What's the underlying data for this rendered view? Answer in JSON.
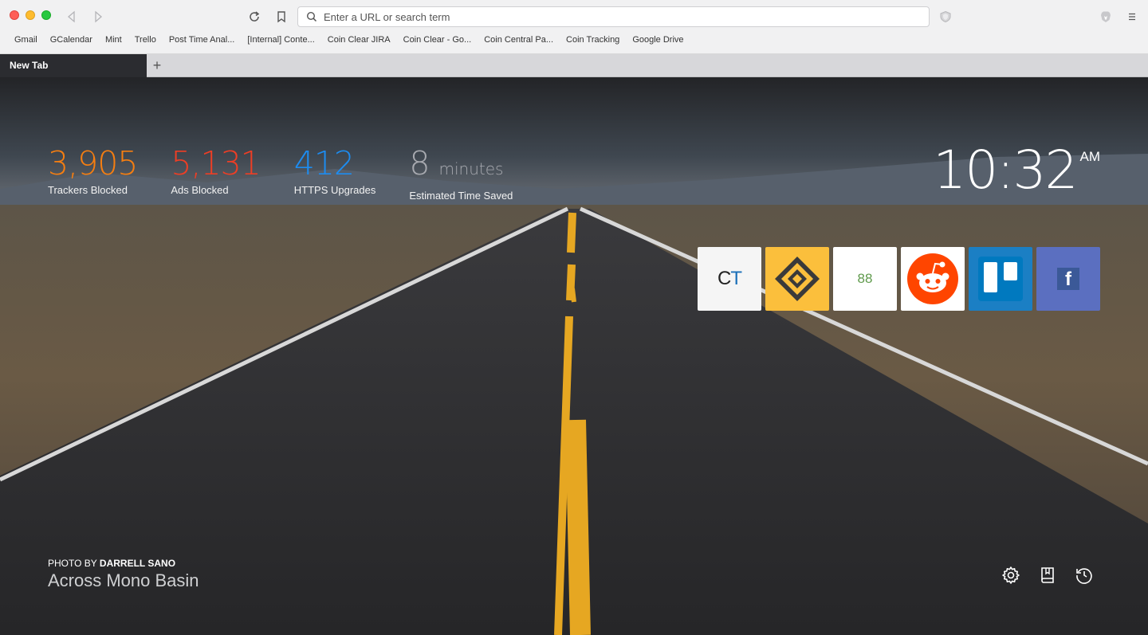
{
  "browser": {
    "url_placeholder": "Enter a URL or search term",
    "bookmarks": [
      "Gmail",
      "GCalendar",
      "Mint",
      "Trello",
      "Post Time Anal...",
      "[Internal] Conte...",
      "Coin Clear JIRA",
      "Coin Clear - Go...",
      "Coin Central Pa...",
      "Coin Tracking",
      "Google Drive"
    ],
    "tab_title": "New Tab",
    "new_tab_label": "+"
  },
  "stats": {
    "trackers": {
      "value": "3,905",
      "label": "Trackers Blocked",
      "color": "#f57e11"
    },
    "ads": {
      "value": "5,131",
      "label": "Ads Blocked",
      "color": "#ee3e25"
    },
    "https": {
      "value": "412",
      "label": "HTTPS Upgrades",
      "color": "#1d8cf0"
    },
    "time": {
      "value": "8",
      "unit": "minutes",
      "label": "Estimated Time Saved",
      "color": "#a8aab0"
    }
  },
  "clock": {
    "time": "10:32",
    "ampm": "AM"
  },
  "top_sites": [
    {
      "name": "coin-tracking",
      "text": "CT"
    },
    {
      "name": "coin-central"
    },
    {
      "name": "site-88",
      "text": "88"
    },
    {
      "name": "reddit"
    },
    {
      "name": "trello"
    },
    {
      "name": "facebook",
      "text": "f"
    }
  ],
  "photo": {
    "by_prefix": "PHOTO BY ",
    "author": "DARRELL SANO",
    "title": "Across Mono Basin"
  },
  "colors": {
    "accent_orange": "#f57e11",
    "accent_red": "#ee3e25",
    "accent_blue": "#1d8cf0"
  }
}
